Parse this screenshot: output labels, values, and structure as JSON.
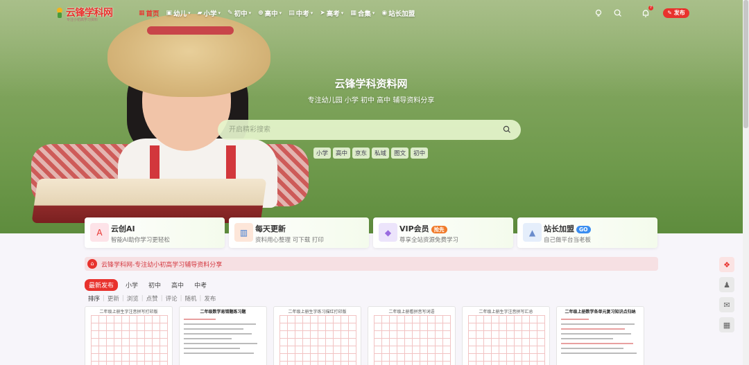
{
  "nav": {
    "logo_text": "云锋学科网",
    "logo_sub": "专注小初高学习资料",
    "menu": [
      {
        "icon": "home-icon",
        "glyph": "▦",
        "label": "首页",
        "active": true,
        "dropdown": false
      },
      {
        "icon": "kids-icon",
        "glyph": "▣",
        "label": "幼儿",
        "active": false,
        "dropdown": true
      },
      {
        "icon": "primary-icon",
        "glyph": "▰",
        "label": "小学",
        "active": false,
        "dropdown": true
      },
      {
        "icon": "junior-icon",
        "glyph": "✎",
        "label": "初中",
        "active": false,
        "dropdown": true
      },
      {
        "icon": "senior-icon",
        "glyph": "⊕",
        "label": "高中",
        "active": false,
        "dropdown": true
      },
      {
        "icon": "zhongkao-icon",
        "glyph": "▤",
        "label": "中考",
        "active": false,
        "dropdown": true
      },
      {
        "icon": "gaokao-icon",
        "glyph": "➤",
        "label": "高考",
        "active": false,
        "dropdown": true
      },
      {
        "icon": "collection-icon",
        "glyph": "▦",
        "label": "合集",
        "active": false,
        "dropdown": true
      },
      {
        "icon": "join-icon",
        "glyph": "◉",
        "label": "站长加盟",
        "active": false,
        "dropdown": false
      }
    ],
    "notification_count": "7",
    "publish_label": "发布"
  },
  "hero": {
    "title": "云锋学科资料网",
    "subtitle": "专注幼儿园 小学 初中 高中 辅导资料分享",
    "search_placeholder": "开启精彩搜索",
    "tags": [
      "小学",
      "高中",
      "京东",
      "私域",
      "图文",
      "初中"
    ]
  },
  "cards": [
    {
      "icon": "ai-icon",
      "glyph": "A",
      "icon_bg": "#fde3e8",
      "icon_color": "#e8322d",
      "title": "云创AI",
      "badge": "",
      "badge_color": "",
      "desc": "智能AI助你学习更轻松"
    },
    {
      "icon": "book-icon",
      "glyph": "▥",
      "icon_bg": "#fde6d9",
      "icon_color": "#3a7bd5",
      "title": "每天更新",
      "badge": "",
      "badge_color": "",
      "desc": "资料用心整理 可下载 打印"
    },
    {
      "icon": "vip-diamond-icon",
      "glyph": "◆",
      "icon_bg": "#ece4fb",
      "icon_color": "#9a6ce0",
      "title": "VIP会员",
      "badge": "抢先",
      "badge_color": "#f07a2a",
      "desc": "尊享全站资源免费学习"
    },
    {
      "icon": "rocket-icon",
      "glyph": "▲",
      "icon_bg": "#e5eefb",
      "icon_color": "#6a8ccc",
      "title": "站长加盟",
      "badge": "GO",
      "badge_color": "#3a8df0",
      "desc": "自己做平台当老板"
    }
  ],
  "notice": {
    "text": "云锋学科网-专注幼小初高学习辅导资料分享"
  },
  "tabs": [
    "最新发布",
    "小学",
    "初中",
    "高中",
    "中考"
  ],
  "sorts": [
    "排序",
    "更新",
    "浏览",
    "点赞",
    "评论",
    "随机",
    "发布"
  ],
  "docs": [
    {
      "title": "二年级上册生字注音拼写打印版",
      "type": "grid",
      "bold": false
    },
    {
      "title": "二年级数学易错题练习题",
      "type": "text",
      "bold": true
    },
    {
      "title": "二年级上册生字练习描红打印版",
      "type": "grid",
      "bold": false
    },
    {
      "title": "二年级上册看拼音写词语",
      "type": "grid",
      "bold": false
    },
    {
      "title": "二年级上册生字注音拼写汇总",
      "type": "grid",
      "bold": false
    },
    {
      "title": "二年级上册数学各单元复习知识点归纳",
      "type": "text",
      "bold": true
    }
  ],
  "floats": [
    "gift-icon",
    "qq-icon",
    "wechat-icon",
    "qrcode-icon"
  ],
  "colors": {
    "accent": "#e8322d",
    "hero_green": "#7ea35b",
    "notice_bg": "#f6e0e3"
  }
}
